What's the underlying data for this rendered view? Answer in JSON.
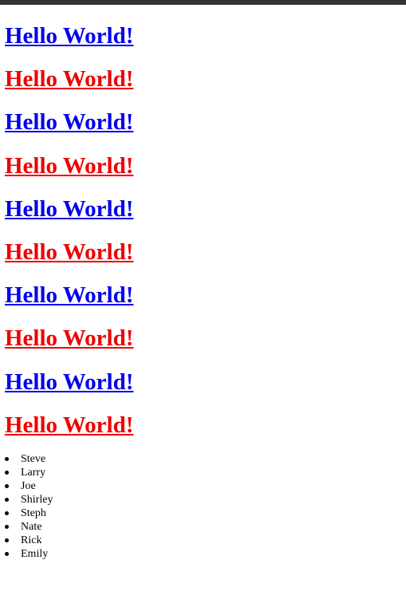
{
  "headings": [
    {
      "text": "Hello World!",
      "color": "#0000ee"
    },
    {
      "text": "Hello World!",
      "color": "#ee0000"
    },
    {
      "text": "Hello World!",
      "color": "#0000ee"
    },
    {
      "text": "Hello World!",
      "color": "#ee0000"
    },
    {
      "text": "Hello World!",
      "color": "#0000ee"
    },
    {
      "text": "Hello World!",
      "color": "#ee0000"
    },
    {
      "text": "Hello World!",
      "color": "#0000ee"
    },
    {
      "text": "Hello World!",
      "color": "#ee0000"
    },
    {
      "text": "Hello World!",
      "color": "#0000ee"
    },
    {
      "text": "Hello World!",
      "color": "#ee0000"
    }
  ],
  "names": [
    "Steve",
    "Larry",
    "Joe",
    "Shirley",
    "Steph",
    "Nate",
    "Rick",
    "Emily"
  ],
  "colors": {
    "top_bar": "#333333",
    "background": "#ffffff"
  }
}
